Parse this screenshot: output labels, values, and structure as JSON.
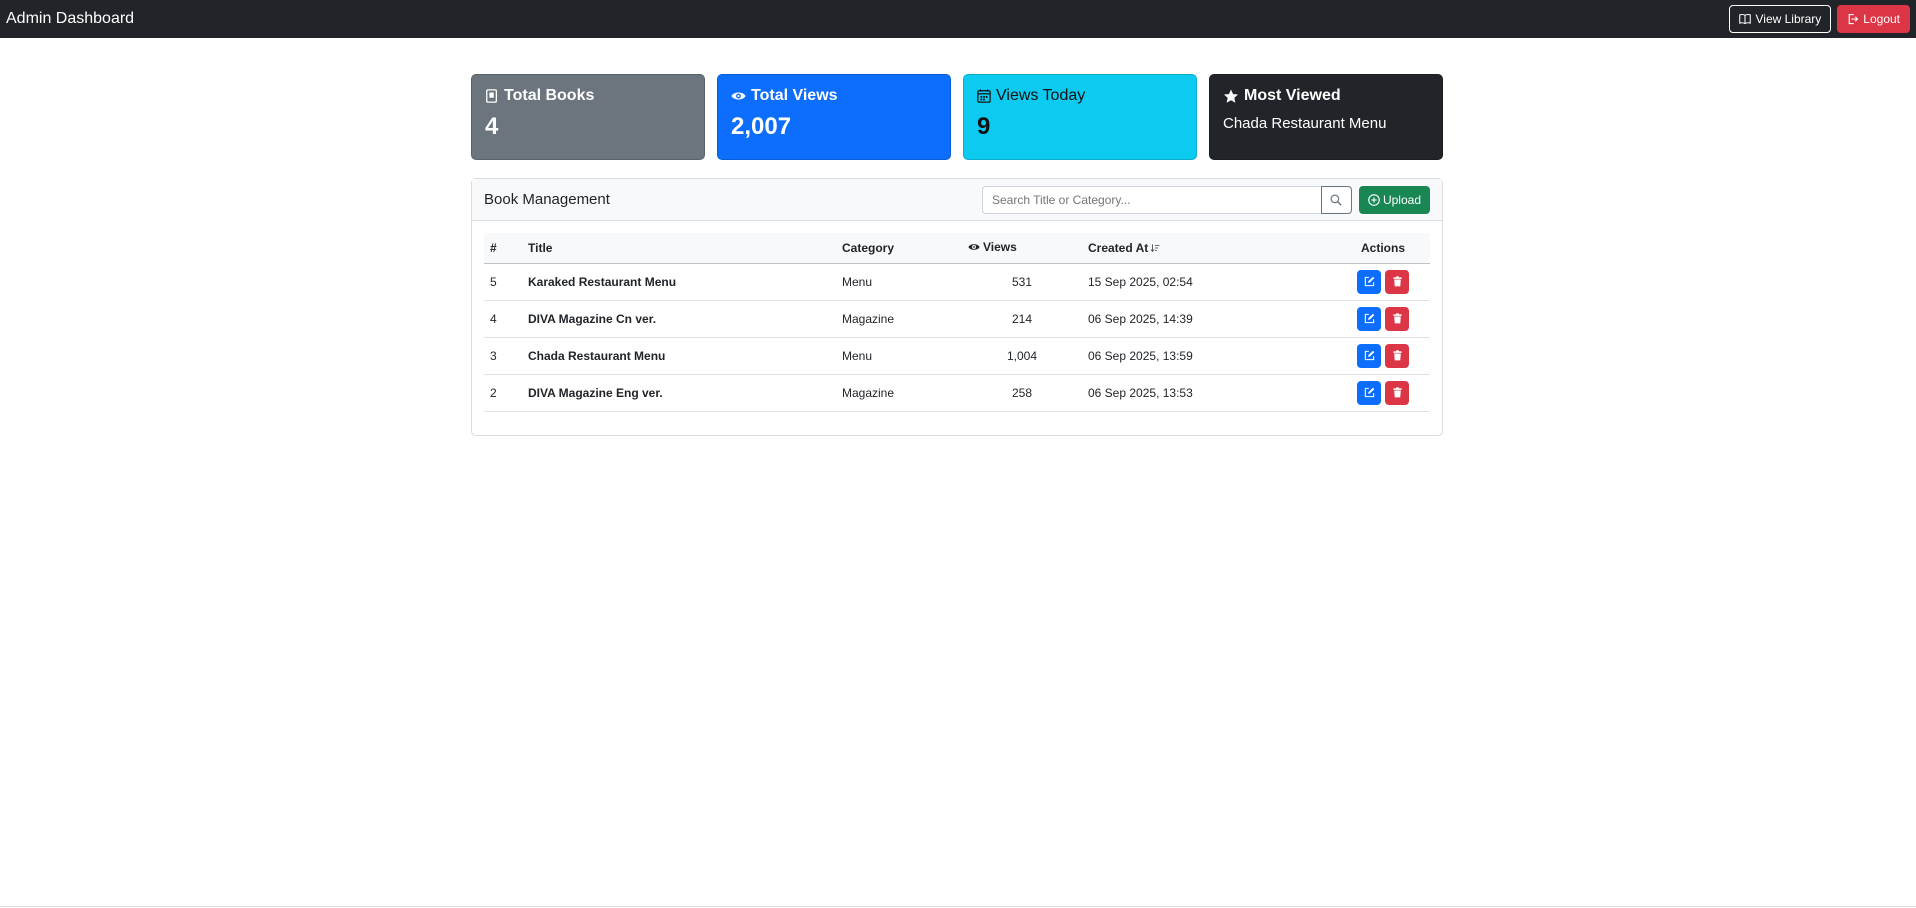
{
  "navbar": {
    "title": "Admin Dashboard",
    "view_library": "View Library",
    "logout": "Logout"
  },
  "stats": [
    {
      "label": "Total Books",
      "value": "4"
    },
    {
      "label": "Total Views",
      "value": "2,007"
    },
    {
      "label": "Views Today",
      "value": "9"
    },
    {
      "label": "Most Viewed",
      "value": "Chada Restaurant Menu"
    }
  ],
  "management": {
    "title": "Book Management",
    "search_placeholder": "Search Title or Category...",
    "upload": "Upload"
  },
  "table": {
    "columns": [
      "#",
      "Title",
      "Category",
      "Views",
      "Created At",
      "Actions"
    ],
    "rows": [
      {
        "id": "5",
        "title": "Karaked Restaurant Menu",
        "category": "Menu",
        "views": "531",
        "created": "15 Sep 2025, 02:54"
      },
      {
        "id": "4",
        "title": "DIVA Magazine Cn ver.",
        "category": "Magazine",
        "views": "214",
        "created": "06 Sep 2025, 14:39"
      },
      {
        "id": "3",
        "title": "Chada Restaurant Menu",
        "category": "Menu",
        "views": "1,004",
        "created": "06 Sep 2025, 13:59"
      },
      {
        "id": "2",
        "title": "DIVA Magazine Eng ver.",
        "category": "Magazine",
        "views": "258",
        "created": "06 Sep 2025, 13:53"
      }
    ]
  },
  "colors": {
    "navbar": "#212529",
    "primary": "#0d6efd",
    "danger": "#dc3545",
    "success": "#198754",
    "info": "#0dcaf0",
    "secondary": "#6c757d"
  }
}
